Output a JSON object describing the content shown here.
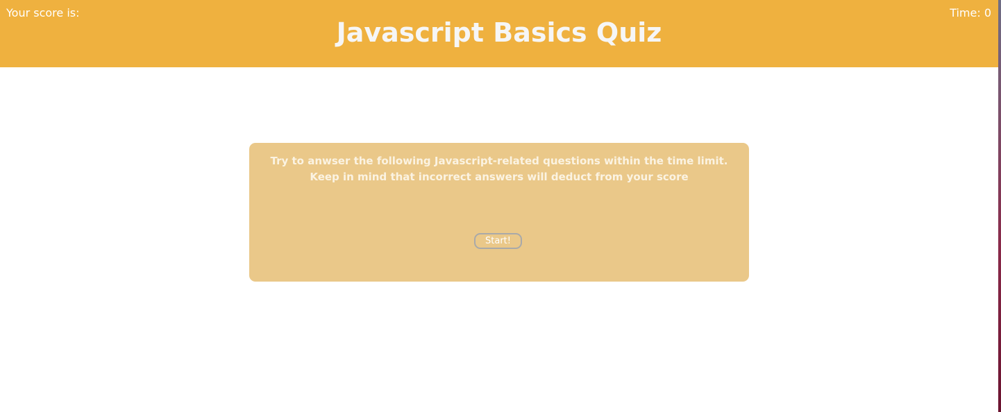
{
  "header": {
    "score_label": "Your score is:",
    "title": "Javascript Basics Quiz",
    "timer_text": "Time: 0"
  },
  "card": {
    "instructions": "Try to anwser the following Javascript-related questions within the time limit. Keep in mind that incorrect answers will deduct from your score",
    "start_label": "Start!"
  },
  "colors": {
    "header_bg": "#efb13f",
    "card_bg": "#eac889",
    "text": "#ffffff"
  }
}
